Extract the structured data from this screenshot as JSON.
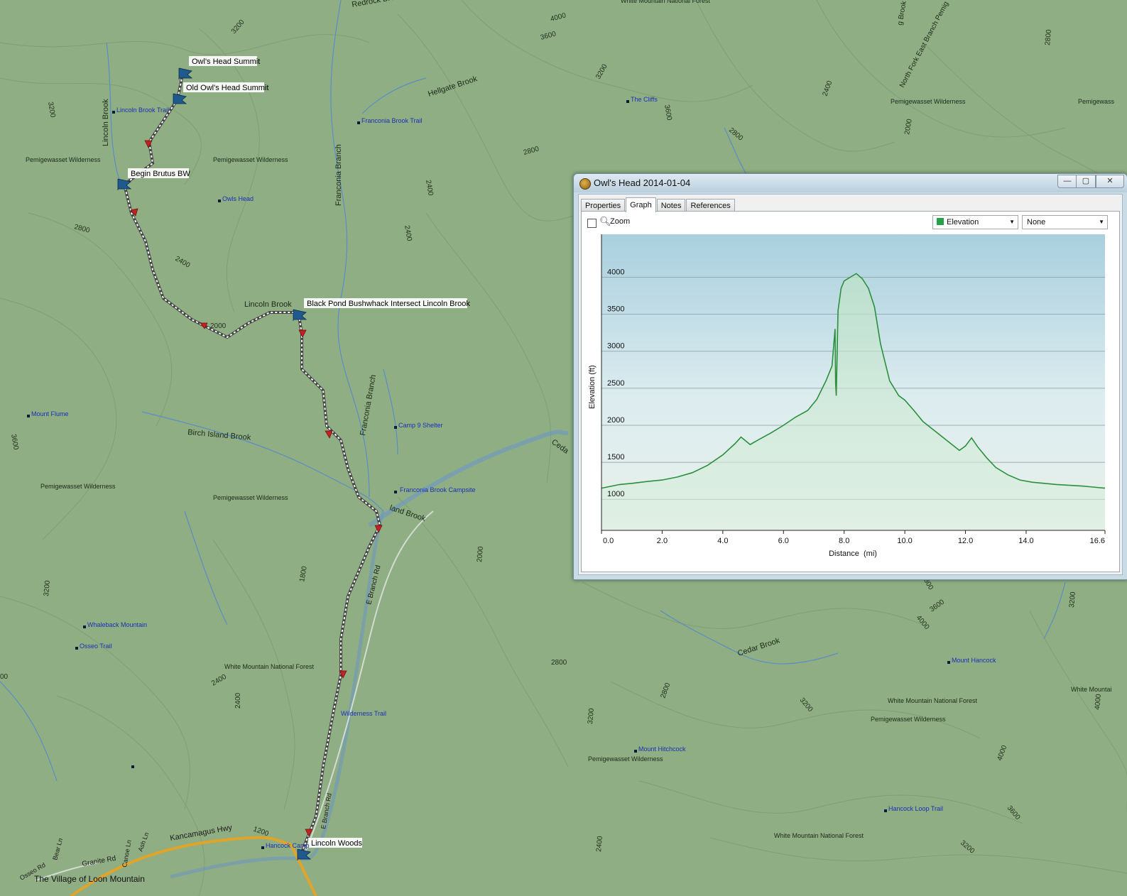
{
  "window": {
    "title": "Owl's Head 2014-01-04",
    "buttons": {
      "minimize": "—",
      "maximize": "▢",
      "close": "✕"
    }
  },
  "tabs": [
    {
      "label": "Properties",
      "active": false
    },
    {
      "label": "Graph",
      "active": true
    },
    {
      "label": "Notes",
      "active": false
    },
    {
      "label": "References",
      "active": false
    }
  ],
  "toolbar": {
    "zoom_label": "Zoom",
    "zoom_checked": false,
    "primary_series": "Elevation",
    "primary_color": "#26a14a",
    "secondary_series": "None"
  },
  "chart_data": {
    "type": "area",
    "xlabel": "Distance  (mi)",
    "ylabel": "Elevation (ft)",
    "xlim": [
      0,
      16.6
    ],
    "ylim": [
      580,
      4580
    ],
    "xticks": [
      "0.0",
      "2.0",
      "4.0",
      "6.0",
      "8.0",
      "10.0",
      "12.0",
      "14.0",
      "16.6"
    ],
    "xtick_values": [
      0,
      2,
      4,
      6,
      8,
      10,
      12,
      14,
      16.6
    ],
    "yticks": [
      "1000",
      "1500",
      "2000",
      "2500",
      "3000",
      "3500",
      "4000"
    ],
    "ytick_values": [
      1000,
      1500,
      2000,
      2500,
      3000,
      3500,
      4000
    ],
    "line_color": "#2b8f3c",
    "series": [
      {
        "x": [
          0,
          0.3,
          0.6,
          1.0,
          1.5,
          2.0,
          2.5,
          3.0,
          3.5,
          4.0,
          4.4,
          4.6,
          4.9,
          5.2,
          5.6,
          6.0,
          6.4,
          6.8,
          7.1,
          7.4,
          7.6,
          7.7,
          7.72,
          7.74,
          7.8,
          7.9,
          8.0,
          8.2,
          8.4,
          8.6,
          8.8,
          9.0,
          9.2,
          9.5,
          9.8,
          10.0,
          10.3,
          10.6,
          11.0,
          11.4,
          11.8,
          12.0,
          12.2,
          12.4,
          12.7,
          13.0,
          13.4,
          13.8,
          14.2,
          14.6,
          15.0,
          15.4,
          15.8,
          16.2,
          16.6
        ],
        "y": [
          1150,
          1175,
          1200,
          1215,
          1240,
          1260,
          1300,
          1360,
          1460,
          1600,
          1750,
          1840,
          1740,
          1810,
          1900,
          2000,
          2110,
          2200,
          2350,
          2600,
          2800,
          3300,
          2560,
          2400,
          3550,
          3850,
          3950,
          4000,
          4050,
          3980,
          3850,
          3600,
          3100,
          2600,
          2400,
          2340,
          2200,
          2050,
          1920,
          1790,
          1660,
          1720,
          1830,
          1710,
          1560,
          1430,
          1330,
          1260,
          1230,
          1215,
          1200,
          1190,
          1180,
          1165,
          1150
        ]
      }
    ]
  },
  "map": {
    "waypoints": [
      "Owl's Head Summit",
      "Old Owl's Head Summit",
      "Begin Brutus BW",
      "Black Pond Bushwhack Intersect Lincoln Brook",
      "Lincoln Woods"
    ],
    "poi": [
      "Lincoln Brook Trail",
      "Franconia Brook Trail",
      "The Cliffs",
      "Owls Head",
      "Mount Flume",
      "Camp 9 Shelter",
      "Franconia Brook Campsite",
      "Whaleback Mountain",
      "Osseo Trail",
      "Mount Hancock",
      "Mount Hitchcock",
      "Hancock Loop Trail",
      "Hancock Camp",
      "Wilderness Trail"
    ],
    "regions": [
      "Pemigewasset Wilderness",
      "White Mountain National Forest",
      "White Mountai",
      "Pemigewass",
      "The Village of Loon Mountain"
    ],
    "water": [
      "Lincoln Brook",
      "Hellgate Brook",
      "Franconia Branch",
      "Birch Island Brook",
      "Cedar Brook",
      "Redrock Brook",
      "North Fork East Branch Pemig",
      "g Brook",
      "land Brook",
      "Ceda"
    ],
    "roads": [
      "Kancamagus Hwy",
      "E Branch Rd",
      "Granite Rd",
      "Osseo Rd",
      "Bear Ln",
      "Canoe Ln",
      "Ash Ln",
      "E Branch Rd"
    ],
    "contours": [
      "3200",
      "3200",
      "2800",
      "2400",
      "2000",
      "1800",
      "4000",
      "3600",
      "3200",
      "2800",
      "2400",
      "2000",
      "2800",
      "2400",
      "3600",
      "2800",
      "3600",
      "4000",
      "3200",
      "3200",
      "2800",
      "3200",
      "2400",
      "2400",
      "2000",
      "1200",
      "4000",
      "4000",
      "3600",
      "3200",
      "2400",
      "2800",
      "2400",
      "3600",
      "3200",
      "2000",
      "2400",
      "3600",
      "2800",
      "3200",
      "00",
      "3600",
      "2800",
      "2400",
      "2000",
      "3200"
    ]
  }
}
